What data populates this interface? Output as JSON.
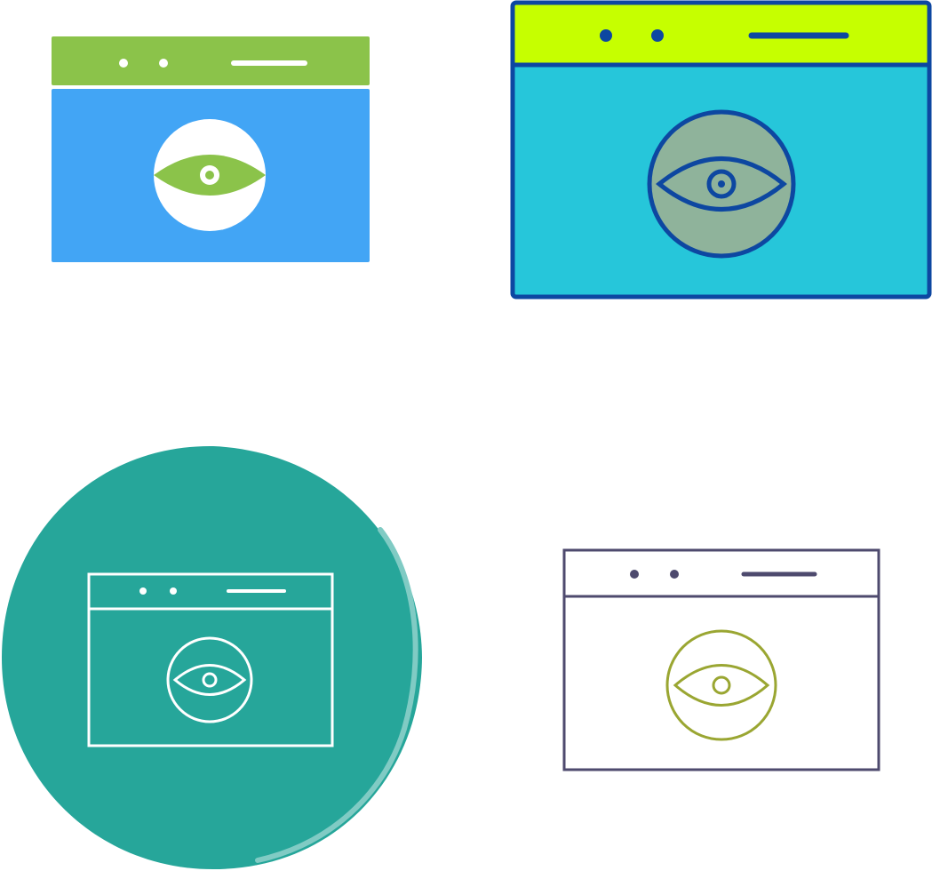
{
  "icons": [
    {
      "name": "browser-eye-glyph-icon",
      "style": "glyph",
      "colors": {
        "header": "#8bc34a",
        "body": "#42a5f5",
        "eye_circle": "#ffffff",
        "eye": "#8bc34a"
      }
    },
    {
      "name": "browser-eye-filled-outline-icon",
      "style": "filled-outline",
      "colors": {
        "header": "#c6ff00",
        "body": "#26c6da",
        "eye_circle": "#8fb39b",
        "stroke": "#0d47a1"
      }
    },
    {
      "name": "browser-eye-circle-badge-icon",
      "style": "white line on circle",
      "colors": {
        "circle": "#26a69a",
        "highlight": "#80cbc4",
        "stroke": "#ffffff"
      }
    },
    {
      "name": "browser-eye-outline-icon",
      "style": "two-tone line",
      "colors": {
        "window_stroke": "#4e4a6e",
        "eye_stroke": "#9aa632"
      }
    }
  ]
}
